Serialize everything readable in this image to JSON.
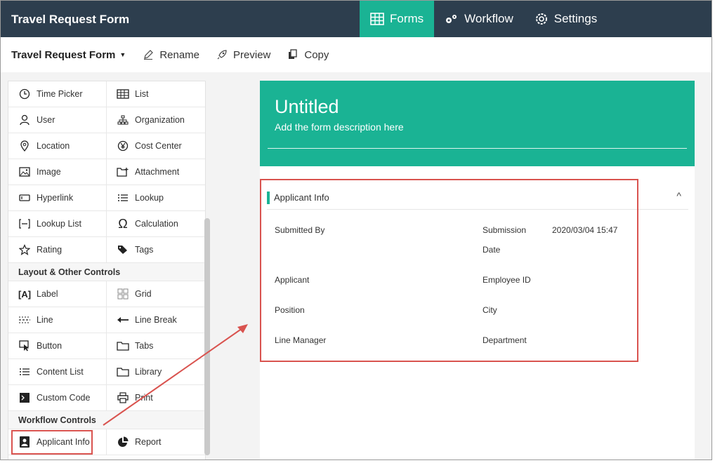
{
  "app": {
    "title": "Travel Request Form"
  },
  "topnav": [
    {
      "label": "Forms",
      "icon": "table-icon",
      "active": true
    },
    {
      "label": "Workflow",
      "icon": "gears-icon",
      "active": false
    },
    {
      "label": "Settings",
      "icon": "gear-icon",
      "active": false
    }
  ],
  "toolbar": {
    "form_name": "Travel Request Form",
    "rename": "Rename",
    "preview": "Preview",
    "copy": "Copy"
  },
  "palette": {
    "basic_rows": [
      [
        "Time Picker",
        "List"
      ],
      [
        "User",
        "Organization"
      ],
      [
        "Location",
        "Cost Center"
      ],
      [
        "Image",
        "Attachment"
      ],
      [
        "Hyperlink",
        "Lookup"
      ],
      [
        "Lookup List",
        "Calculation"
      ],
      [
        "Rating",
        "Tags"
      ]
    ],
    "layout_heading": "Layout & Other Controls",
    "layout_rows": [
      [
        "Label",
        "Grid"
      ],
      [
        "Line",
        "Line Break"
      ],
      [
        "Button",
        "Tabs"
      ],
      [
        "Content List",
        "Library"
      ],
      [
        "Custom Code",
        "Print"
      ]
    ],
    "workflow_heading": "Workflow Controls",
    "workflow_rows": [
      [
        "Applicant Info",
        "Report"
      ]
    ]
  },
  "form": {
    "title": "Untitled",
    "description": "Add the form description here",
    "section_title": "Applicant Info",
    "fields": {
      "submitted_by": "Submitted By",
      "submission_date_1": "Submission",
      "submission_date_2": "Date",
      "submission_date_value": "2020/03/04 15:47",
      "applicant": "Applicant",
      "employee_id": "Employee ID",
      "position": "Position",
      "city": "City",
      "line_manager": "Line Manager",
      "department": "Department"
    }
  },
  "colors": {
    "topbar": "#2d3e4e",
    "accent": "#1ab394",
    "annotation": "#d9534f"
  }
}
